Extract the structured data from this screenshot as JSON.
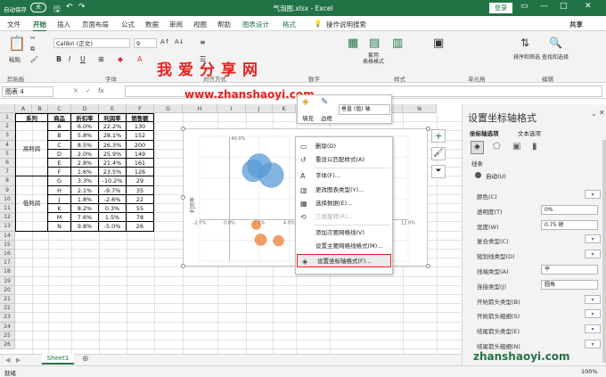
{
  "titlebar": {
    "autosave": "自动保存",
    "autosave_state": "关",
    "filename": "气泡图.xlsx - Excel",
    "login": "登录"
  },
  "tabs": [
    "文件",
    "开始",
    "插入",
    "页面布局",
    "公式",
    "数据",
    "审阅",
    "视图",
    "帮助",
    "图表设计",
    "格式"
  ],
  "tell_me": "操作说明搜索",
  "share": "共享",
  "ribbon": {
    "font_name": "Calibri (正文)",
    "font_size": "9",
    "groups": [
      "剪贴板",
      "字体",
      "对齐方式",
      "数字",
      "样式",
      "单元格",
      "编辑"
    ],
    "paste": "粘贴",
    "conditional": "条件格式",
    "table_fmt": "套用\n表格格式",
    "cell_style": "单元格样式",
    "cells": "单元格",
    "sort": "排序和筛选",
    "find": "查找和选择"
  },
  "watermark": {
    "main": "我爱分享网",
    "url": "www.zhanshaoyi.com",
    "bottom": "zhanshaoyi.com"
  },
  "namebox": "图表 4",
  "fx": "fx",
  "columns": [
    "A",
    "B",
    "C",
    "D",
    "E",
    "F",
    "G",
    "H",
    "I",
    "J",
    "K",
    "L",
    "M",
    "N"
  ],
  "rows": [
    "1",
    "2",
    "3",
    "4",
    "5",
    "6",
    "7",
    "8",
    "9",
    "10",
    "11",
    "12",
    "13",
    "14",
    "15",
    "16",
    "17",
    "18",
    "19",
    "20",
    "21",
    "22",
    "23",
    "24",
    "25",
    "26"
  ],
  "table": {
    "headers": [
      "系列",
      "商品",
      "折扣率",
      "利润率",
      "销售额"
    ],
    "group1": "高利润",
    "group2": "低利润",
    "rows": [
      [
        "A",
        "6.0%",
        "22.2%",
        "130"
      ],
      [
        "B",
        "5.8%",
        "28.1%",
        "152"
      ],
      [
        "C",
        "8.5%",
        "26.3%",
        "200"
      ],
      [
        "D",
        "2.0%",
        "25.9%",
        "149"
      ],
      [
        "E",
        "2.8%",
        "21.4%",
        "161"
      ],
      [
        "F",
        "1.6%",
        "23.5%",
        "126"
      ],
      [
        "G",
        "3.3%",
        "-10.2%",
        "29"
      ],
      [
        "H",
        "2.1%",
        "-9.7%",
        "35"
      ],
      [
        "J",
        "1.8%",
        "-2.6%",
        "22"
      ],
      [
        "K",
        "8.2%",
        "0.3%",
        "55"
      ],
      [
        "M",
        "7.6%",
        "1.5%",
        "78"
      ],
      [
        "N",
        "9.8%",
        "-5.0%",
        "26"
      ]
    ]
  },
  "chart": {
    "y_title": "利润率",
    "x_ticks": [
      "-2.0%",
      "0.0%",
      "2.0%",
      "4.0%",
      "6.0%",
      "8.0%",
      "10.0%",
      "12.0%"
    ],
    "y_top": "40.0%"
  },
  "mini_toolbar": {
    "fill": "填充",
    "outline": "边框",
    "selector": "垂直 (值) 轴"
  },
  "context_menu": [
    {
      "label": "删除(D)",
      "icon": "delete-icon",
      "enabled": true
    },
    {
      "label": "重设以匹配样式(A)",
      "icon": "reset-style-icon",
      "enabled": true
    },
    {
      "label": "字体(F)...",
      "icon": "font-icon",
      "enabled": true
    },
    {
      "label": "更改图表类型(Y)...",
      "icon": "chart-type-icon",
      "enabled": true
    },
    {
      "label": "选择数据(E)...",
      "icon": "select-data-icon",
      "enabled": true
    },
    {
      "label": "三维旋转(R)...",
      "icon": "3d-rotation-icon",
      "enabled": false
    },
    {
      "label": "添加次要网格线(V)",
      "icon": "",
      "enabled": true
    },
    {
      "label": "设置主要网格线格式(M)...",
      "icon": "",
      "enabled": true
    },
    {
      "label": "设置坐标轴格式(F)...",
      "icon": "format-axis-icon",
      "enabled": true
    }
  ],
  "panel": {
    "title": "设置坐标轴格式",
    "tab1": "坐标轴选项",
    "tab2": "文本选项",
    "line": "线条",
    "auto": "自动(U)",
    "props": [
      {
        "label": "颜色(C)",
        "value": ""
      },
      {
        "label": "透明度(T)",
        "value": "0%"
      },
      {
        "label": "宽度(W)",
        "value": "0.75 磅"
      },
      {
        "label": "复合类型(C)",
        "value": ""
      },
      {
        "label": "短划线类型(D)",
        "value": ""
      },
      {
        "label": "线端类型(A)",
        "value": "平"
      },
      {
        "label": "连接类型(J)",
        "value": "圆角"
      },
      {
        "label": "开始箭头类型(B)",
        "value": ""
      },
      {
        "label": "开始箭头粗细(S)",
        "value": ""
      },
      {
        "label": "结尾箭头类型(E)",
        "value": ""
      },
      {
        "label": "结尾箭头粗细(N)",
        "value": ""
      }
    ]
  },
  "sheet": "Sheet1",
  "status": "就绪",
  "zoom": "100%",
  "chart_data": {
    "type": "bubble",
    "series": [
      {
        "name": "高利润",
        "x": [
          6.0,
          5.8,
          8.5,
          2.0,
          2.8,
          1.6
        ],
        "y": [
          22.2,
          28.1,
          26.3,
          25.9,
          21.4,
          23.5
        ],
        "size": [
          130,
          152,
          200,
          149,
          161,
          126
        ]
      },
      {
        "name": "低利润",
        "x": [
          3.3,
          2.1,
          1.8,
          8.2,
          7.6,
          9.8
        ],
        "y": [
          -10.2,
          -9.7,
          -2.6,
          0.3,
          1.5,
          -5.0
        ],
        "size": [
          29,
          35,
          22,
          55,
          78,
          26
        ]
      }
    ],
    "colors": [
      "#5b9bd5",
      "#ed7d31"
    ]
  }
}
